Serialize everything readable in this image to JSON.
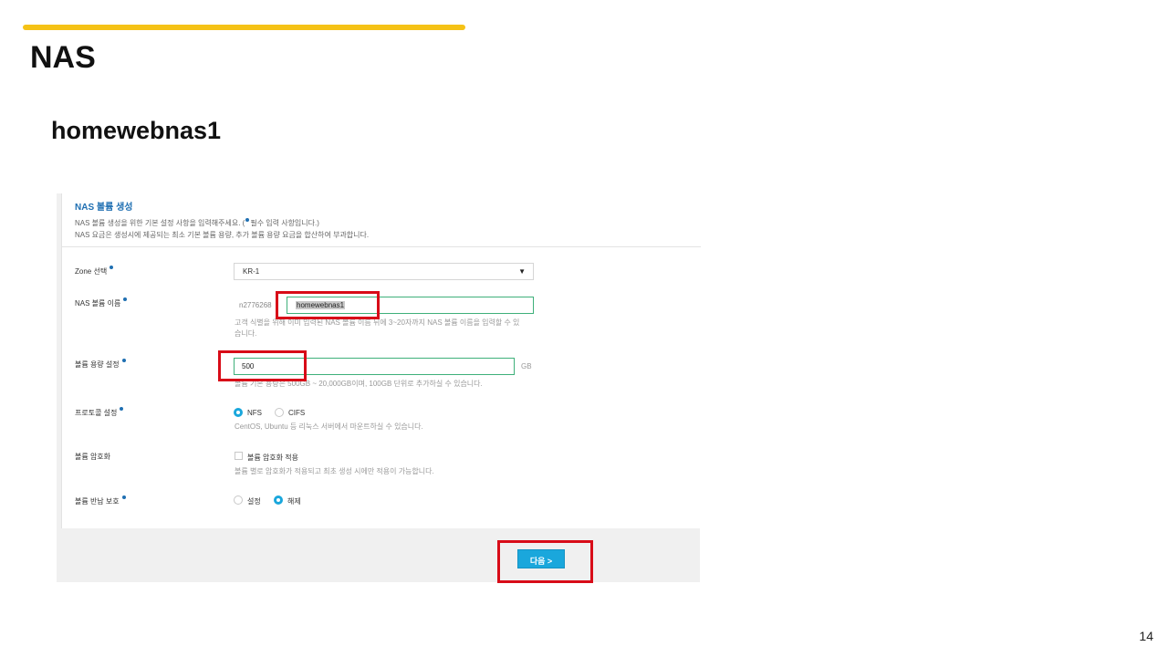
{
  "slide": {
    "title": "NAS",
    "subtitle": "homewebnas1",
    "page_number": "14"
  },
  "form": {
    "title": "NAS 볼륨 생성",
    "desc_line1_before": "NAS 볼륨 생성을 위한 기본 설정 사항을 입력해주세요. (",
    "desc_line1_after": "필수 입력 사항입니다.)",
    "desc_line2": "NAS 요금은 생성시에 제공되는 최소 기본 볼륨 용량, 추가 볼륨 용량 요금을 합산하여 부과합니다.",
    "zone": {
      "label": "Zone 선택",
      "value": "KR-1"
    },
    "volume_name": {
      "label": "NAS 볼륨 이름",
      "prefix": "n2776268",
      "value": "homewebnas1",
      "hint_line1": "고객 식별을 위해 이미 입력된 NAS 볼륨 이름 뒤에 3~20자까지 NAS 볼륨 이름을 입력할 수 있",
      "hint_line2": "습니다."
    },
    "volume_size": {
      "label": "볼륨 용량 설정",
      "value": "500",
      "unit": "GB",
      "hint": "볼륨 기본 용량은 500GB ~ 20,000GB이며, 100GB 단위로 추가하실 수 있습니다."
    },
    "protocol": {
      "label": "프로토콜 설정",
      "options": [
        "NFS",
        "CIFS"
      ],
      "selected": "NFS",
      "hint": "CentOS, Ubuntu 등 리눅스 서버에서 마운트하실 수 있습니다."
    },
    "encryption": {
      "label": "볼륨 암호화",
      "checkbox_label": "볼륨 암호화 적용",
      "checked": false,
      "hint": "볼륨 별로 암호화가 적용되고 최초 생성 시에만 적용이 가능합니다."
    },
    "return_protection": {
      "label": "볼륨 반납 보호",
      "options": [
        "설정",
        "해제"
      ],
      "selected": "해제"
    },
    "next_button": "다음  >"
  },
  "colors": {
    "accent_bar": "#f5c216",
    "form_title": "#1f6fb2",
    "input_border": "#3eb07a",
    "radio_on": "#1aa7dc",
    "button": "#1aa7dc",
    "annotation": "#d80c18"
  }
}
